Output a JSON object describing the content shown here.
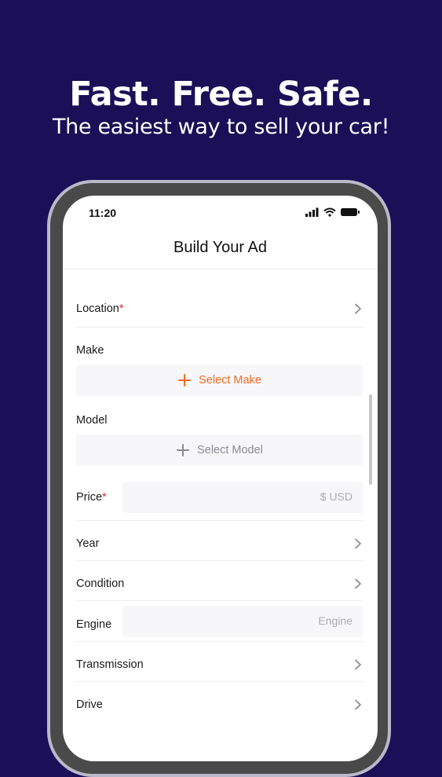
{
  "hero": {
    "headline": "Fast. Free. Safe.",
    "subline": "The easiest way to sell your car!"
  },
  "status_bar": {
    "time": "11:20"
  },
  "screen": {
    "title": "Build Your Ad"
  },
  "form": {
    "location": {
      "label": "Location",
      "required": "*"
    },
    "make": {
      "label": "Make",
      "select_text": "Select Make"
    },
    "model": {
      "label": "Model",
      "select_text": "Select Model"
    },
    "price": {
      "label": "Price",
      "required": "*",
      "placeholder": "$ USD"
    },
    "year": {
      "label": "Year"
    },
    "condition": {
      "label": "Condition"
    },
    "engine": {
      "label": "Engine",
      "placeholder": "Engine"
    },
    "transmission": {
      "label": "Transmission"
    },
    "drive": {
      "label": "Drive"
    }
  },
  "colors": {
    "background": "#1b0f57",
    "accent": "#f26a21",
    "required": "#d62c2c",
    "muted": "#8a8a94"
  },
  "icons": {
    "chevron": "chevron-right-icon",
    "plus": "plus-icon",
    "signal": "cellular-signal-icon",
    "wifi": "wifi-icon",
    "battery": "battery-icon"
  }
}
